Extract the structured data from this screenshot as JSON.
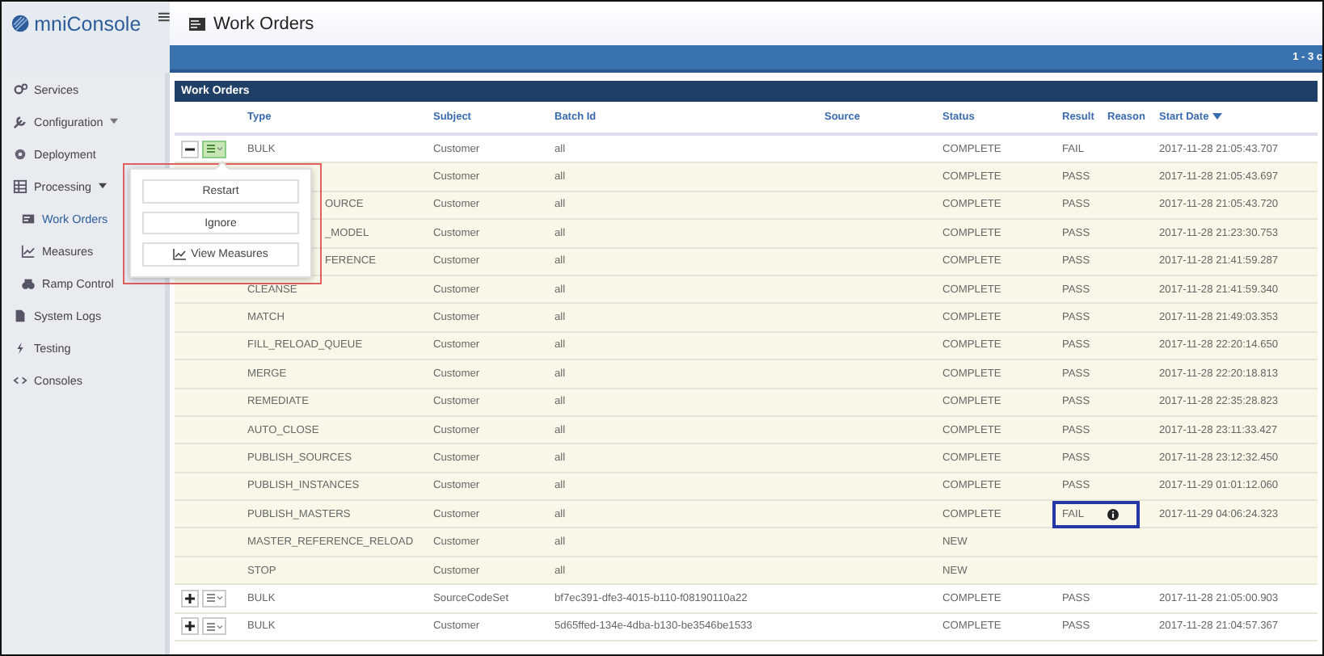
{
  "header": {
    "logo": "mniConsole",
    "title": "Work Orders",
    "pager": "1 - 3 c"
  },
  "sidebar": {
    "items": [
      {
        "label": "Services",
        "selected": false
      },
      {
        "label": "Configuration",
        "selected": false,
        "expanded": false
      },
      {
        "label": "Deployment",
        "selected": false
      },
      {
        "label": "Processing",
        "selected": false,
        "expanded": true,
        "children": [
          {
            "label": "Work Orders",
            "selected": true
          },
          {
            "label": "Measures",
            "selected": false
          },
          {
            "label": "Ramp Control",
            "selected": false
          }
        ]
      },
      {
        "label": "System Logs",
        "selected": false
      },
      {
        "label": "Testing",
        "selected": false
      },
      {
        "label": "Consoles",
        "selected": false
      }
    ]
  },
  "panel": {
    "title": "Work Orders"
  },
  "table": {
    "columns": [
      "Type",
      "Subject",
      "Batch Id",
      "Source",
      "Status",
      "Result",
      "Reason",
      "Start Date"
    ],
    "rows": [
      {
        "kind": "parent",
        "expanded": true,
        "menu_open": true,
        "type": "BULK",
        "subject": "Customer",
        "batch_id": "all",
        "status": "COMPLETE",
        "result": "FAIL",
        "start_date": "2017-11-28 21:05:43.707"
      },
      {
        "kind": "child",
        "subject": "Customer",
        "batch_id": "all",
        "status": "COMPLETE",
        "result": "PASS",
        "start_date": "2017-11-28 21:05:43.697"
      },
      {
        "kind": "child",
        "type": "OURCE",
        "subject": "Customer",
        "batch_id": "all",
        "status": "COMPLETE",
        "result": "PASS",
        "start_date": "2017-11-28 21:05:43.720"
      },
      {
        "kind": "child",
        "type": "_MODEL",
        "subject": "Customer",
        "batch_id": "all",
        "status": "COMPLETE",
        "result": "PASS",
        "start_date": "2017-11-28 21:23:30.753"
      },
      {
        "kind": "child",
        "type": "FERENCE",
        "subject": "Customer",
        "batch_id": "all",
        "status": "COMPLETE",
        "result": "PASS",
        "start_date": "2017-11-28 21:41:59.287"
      },
      {
        "kind": "child",
        "type": "CLEANSE",
        "subject": "Customer",
        "batch_id": "all",
        "status": "COMPLETE",
        "result": "PASS",
        "start_date": "2017-11-28 21:41:59.340"
      },
      {
        "kind": "child",
        "type": "MATCH",
        "subject": "Customer",
        "batch_id": "all",
        "status": "COMPLETE",
        "result": "PASS",
        "start_date": "2017-11-28 21:49:03.353"
      },
      {
        "kind": "child",
        "type": "FILL_RELOAD_QUEUE",
        "subject": "Customer",
        "batch_id": "all",
        "status": "COMPLETE",
        "result": "PASS",
        "start_date": "2017-11-28 22:20:14.650"
      },
      {
        "kind": "child",
        "type": "MERGE",
        "subject": "Customer",
        "batch_id": "all",
        "status": "COMPLETE",
        "result": "PASS",
        "start_date": "2017-11-28 22:20:18.813"
      },
      {
        "kind": "child",
        "type": "REMEDIATE",
        "subject": "Customer",
        "batch_id": "all",
        "status": "COMPLETE",
        "result": "PASS",
        "start_date": "2017-11-28 22:35:28.823"
      },
      {
        "kind": "child",
        "type": "AUTO_CLOSE",
        "subject": "Customer",
        "batch_id": "all",
        "status": "COMPLETE",
        "result": "PASS",
        "start_date": "2017-11-28 23:11:33.427"
      },
      {
        "kind": "child",
        "type": "PUBLISH_SOURCES",
        "subject": "Customer",
        "batch_id": "all",
        "status": "COMPLETE",
        "result": "PASS",
        "start_date": "2017-11-28 23:12:32.450"
      },
      {
        "kind": "child",
        "type": "PUBLISH_INSTANCES",
        "subject": "Customer",
        "batch_id": "all",
        "status": "COMPLETE",
        "result": "PASS",
        "start_date": "2017-11-29 01:01:12.060"
      },
      {
        "kind": "child",
        "type": "PUBLISH_MASTERS",
        "subject": "Customer",
        "batch_id": "all",
        "status": "COMPLETE",
        "result": "FAIL",
        "reason_info": true,
        "highlighted": true,
        "start_date": "2017-11-29 04:06:24.323"
      },
      {
        "kind": "child",
        "type": "MASTER_REFERENCE_RELOAD",
        "subject": "Customer",
        "batch_id": "all",
        "status": "NEW"
      },
      {
        "kind": "child",
        "type": "STOP",
        "subject": "Customer",
        "batch_id": "all",
        "status": "NEW"
      },
      {
        "kind": "parent",
        "expanded": false,
        "menu_open": false,
        "type": "BULK",
        "subject": "SourceCodeSet",
        "batch_id": "bf7ec391-dfe3-4015-b110-f08190110a22",
        "status": "COMPLETE",
        "result": "PASS",
        "start_date": "2017-11-28 21:05:00.903"
      },
      {
        "kind": "parent",
        "expanded": false,
        "menu_open": false,
        "type": "BULK",
        "subject": "Customer",
        "batch_id": "5d65ffed-134e-4dba-b130-be3546be1533",
        "status": "COMPLETE",
        "result": "PASS",
        "start_date": "2017-11-28 21:04:57.367"
      }
    ]
  },
  "row_menu": {
    "highlighted": true,
    "actions": [
      "Restart",
      "Ignore",
      "View Measures"
    ]
  }
}
